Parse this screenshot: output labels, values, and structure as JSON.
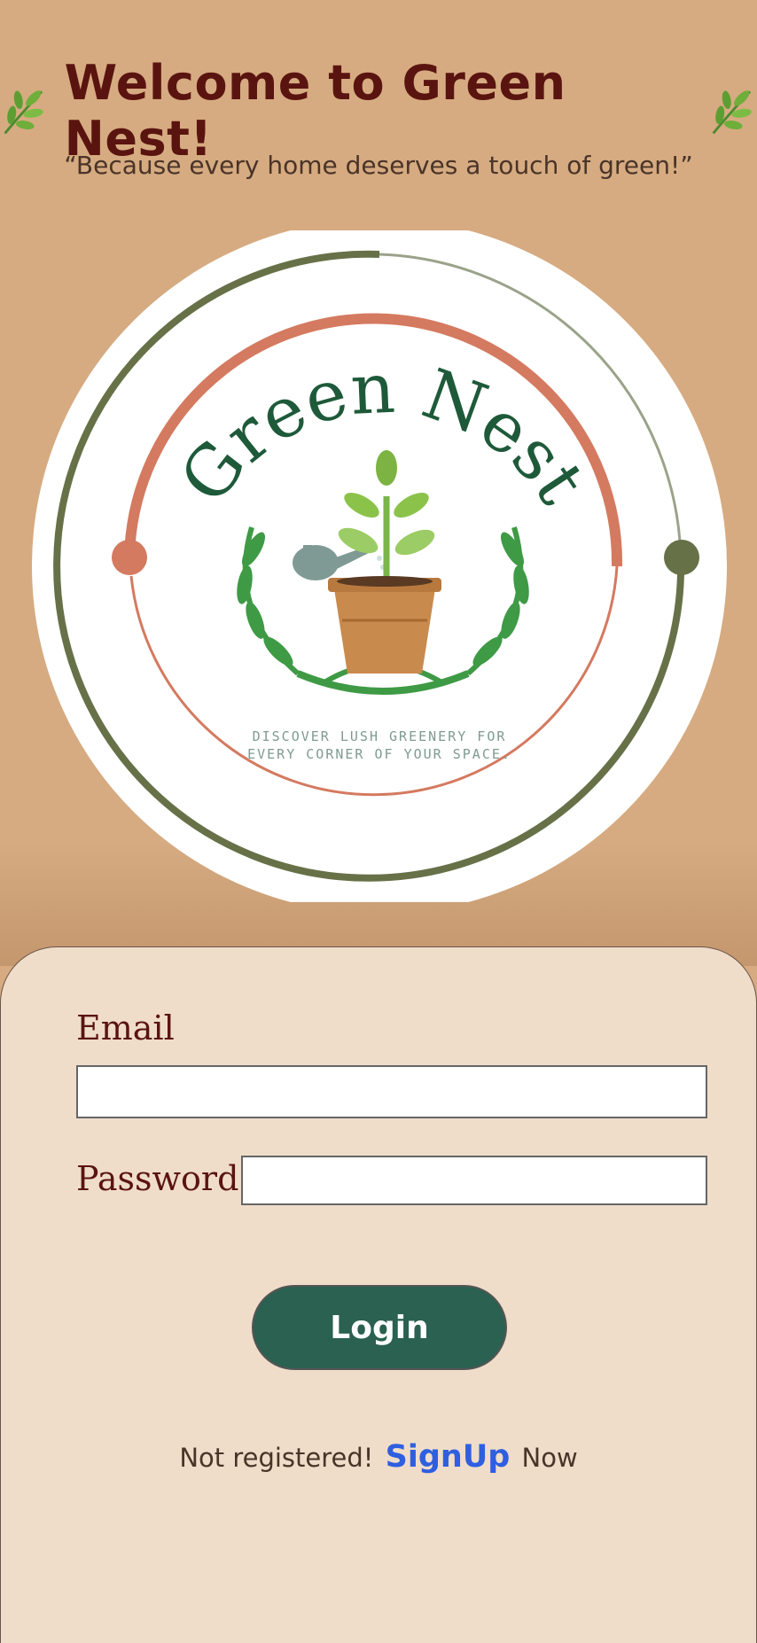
{
  "header": {
    "title": "Welcome to Green Nest!",
    "tagline": "“Because every home deserves a touch of green!”",
    "decor_icon": "herb-leaf-icon"
  },
  "logo": {
    "brand_name": "Green Nest",
    "slogan_line1": "DISCOVER LUSH GREENERY FOR",
    "slogan_line2": "EVERY CORNER OF YOUR SPACE.",
    "icons": [
      "potted-plant-icon",
      "watering-can-icon",
      "laurel-wreath-icon"
    ]
  },
  "form": {
    "email_label": "Email",
    "email_value": "",
    "password_label": "Password",
    "password_value": "",
    "login_label": "Login"
  },
  "signup": {
    "prefix": "Not registered!",
    "link_label": "SignUp",
    "suffix": "Now"
  },
  "colors": {
    "background": "#d6ab81",
    "card": "#efddca",
    "title": "#5a1410",
    "button": "#2a6150",
    "link": "#2f5fe0",
    "ring_green": "#667148",
    "ring_terracotta": "#d47a60"
  }
}
